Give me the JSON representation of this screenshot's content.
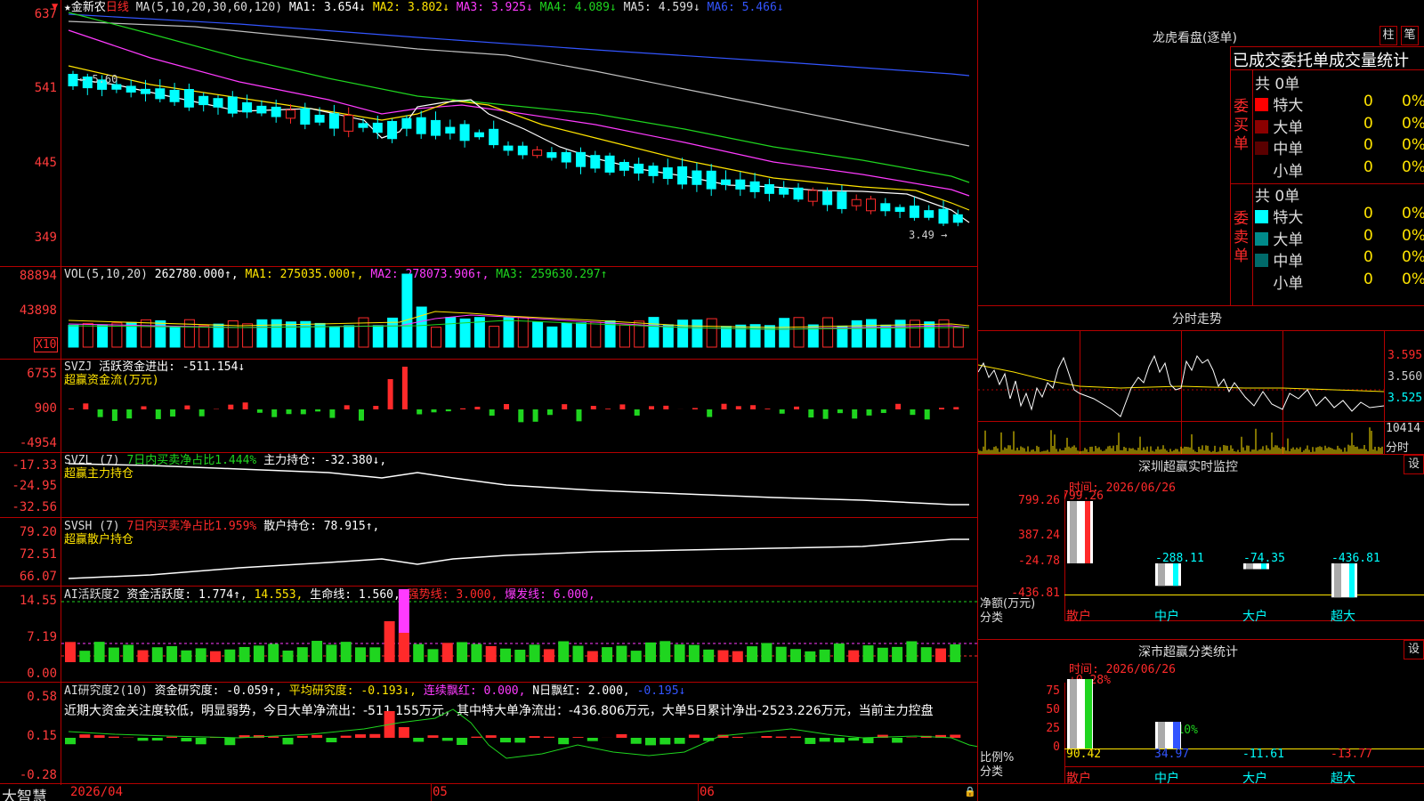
{
  "kline": {
    "star": "★",
    "name": "金新农",
    "period": "日线",
    "ma_params": "MA(5,10,20,30,60,120)",
    "ma1": "MA1: 3.654↓",
    "ma2": "MA2: 3.802↓",
    "ma3": "MA3: 3.925↓",
    "ma4": "MA4: 4.089↓",
    "ma5": "MA5: 4.599↓",
    "ma6": "MA6: 5.466↓",
    "high_mark": "5.60",
    "low_mark": "3.49",
    "y": [
      "637",
      "541",
      "445",
      "349"
    ],
    "colors": {
      "ma1": "#ffffff",
      "ma2": "#ffe400",
      "ma3": "#ff3bff",
      "ma4": "#1fd51f",
      "ma5": "#c0c0c0",
      "ma6": "#3355ff",
      "up": "#ff2a2a",
      "down": "#00ffff"
    }
  },
  "vol": {
    "params": "VOL(5,10,20)",
    "value": "262780.000↑,",
    "ma1": "MA1: 275035.000↑,",
    "ma2": "MA2: 278073.906↑,",
    "ma3": "MA3: 259630.297↑",
    "y": [
      "88894",
      "43898"
    ],
    "unit": "X10"
  },
  "svzj": {
    "title": "SVZJ",
    "label": "活跃资金进出: -511.154↓",
    "sub": "超赢资金流(万元)",
    "y": [
      "6755",
      "900",
      "-4954"
    ]
  },
  "svzl": {
    "title": "SVZL (7)",
    "label": "7日内买卖净占比1.444%",
    "label2": "主力持仓: -32.380↓,",
    "sub": "超赢主力持仓",
    "y": [
      "-17.33",
      "-24.95",
      "-32.56"
    ]
  },
  "svsh": {
    "title": "SVSH (7)",
    "label": "7日内买卖净占比1.959%",
    "label2": "散户持仓: 78.915↑,",
    "sub": "超赢散户持仓",
    "y": [
      "79.20",
      "72.51",
      "66.07"
    ]
  },
  "ai1": {
    "title": "AI活跃度2",
    "label": "资金活跃度: 1.774↑,",
    "v2": "14.553,",
    "v3": "生命线: 1.560,",
    "v4": "强势线: 3.000,",
    "v5": "爆发线: 6.000,",
    "y": [
      "14.55",
      "7.19",
      "0.00"
    ]
  },
  "ai2": {
    "title": "AI研究度2(10)",
    "label": "资金研究度: -0.059↑,",
    "v2": "平均研究度: -0.193↓,",
    "v3": "连续飘红: 0.000,",
    "v4": "N日飘红: 2.000,",
    "v5": "-0.195↓",
    "comment": "近期大资金关注度较低，明显弱势，今日大单净流出：-511.155万元，其中特大单净流出：-436.806万元，大单5日累计净出-2523.226万元，当前主力控盘",
    "y": [
      "0.58",
      "0.15",
      "-0.28"
    ]
  },
  "xaxis": {
    "d1": "2026/04",
    "d2": "05",
    "d3": "06"
  },
  "brand": "大智慧",
  "lhb": {
    "title": "龙虎看盘(逐单)",
    "btn1": "柱",
    "btn2": "笔",
    "header": "已成交委托单成交量统计",
    "buy_side": "委买单",
    "sell_side": "委卖单",
    "buy_total": "共 0单",
    "sell_total": "共 0单",
    "rows_buy": [
      {
        "name": "特大",
        "n": "0",
        "p": "0%",
        "c": "#ff0000"
      },
      {
        "name": "大单",
        "n": "0",
        "p": "0%",
        "c": "#8b0000"
      },
      {
        "name": "中单",
        "n": "0",
        "p": "0%",
        "c": "#5a0000"
      },
      {
        "name": "小单",
        "n": "0",
        "p": "0%",
        "c": "#000000"
      }
    ],
    "rows_sell": [
      {
        "name": "特大",
        "n": "0",
        "p": "0%",
        "c": "#00ffff"
      },
      {
        "name": "大单",
        "n": "0",
        "p": "0%",
        "c": "#008b8b"
      },
      {
        "name": "中单",
        "n": "0",
        "p": "0%",
        "c": "#006a6a"
      },
      {
        "name": "小单",
        "n": "0",
        "p": "0%",
        "c": "#000000"
      }
    ]
  },
  "intraday": {
    "title": "分时走势",
    "y": [
      "3.595",
      "3.560",
      "3.525"
    ],
    "vol": "10414",
    "vol_label": "分时"
  },
  "monitor": {
    "title": "深圳超赢实时监控",
    "btn": "设",
    "time": "时间: 2026/06/26",
    "y": [
      "799.26",
      "387.24",
      "-24.78",
      "-436.81"
    ],
    "ylabel": "净额(万元)",
    "xlabel": "分类",
    "cats": [
      "散户",
      "中户",
      "大户",
      "超大"
    ],
    "vals": [
      "799.26",
      "-288.11",
      "-74.35",
      "-436.81"
    ]
  },
  "classify": {
    "title": "深市超赢分类统计",
    "btn": "设",
    "time": "时间: 2026/06/26",
    "top": "+0.28%",
    "mid": "-0.10%",
    "y": [
      "75",
      "50",
      "25",
      "0"
    ],
    "ylabel": "比例%",
    "xlabel": "分类",
    "cats": [
      "散户",
      "中户",
      "大户",
      "超大"
    ],
    "vals": [
      "90.42",
      "34.97",
      "-11.61",
      "-13.77"
    ]
  }
}
